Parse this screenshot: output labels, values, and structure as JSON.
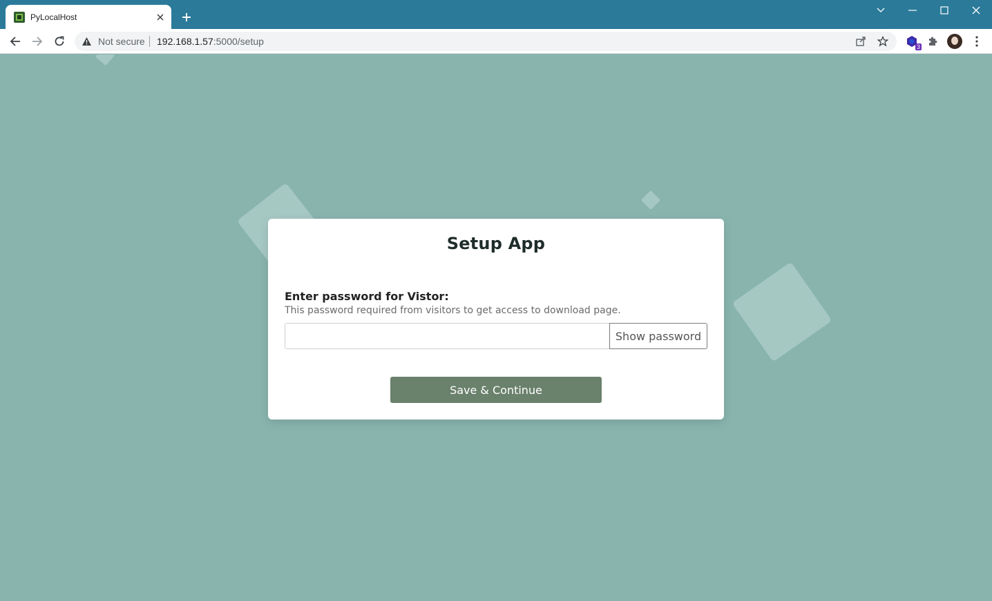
{
  "browser": {
    "tab": {
      "title": "PyLocalHost"
    },
    "address_bar": {
      "security_label": "Not secure",
      "url_host": "192.168.1.57",
      "url_rest": ":5000/setup"
    },
    "extension_badge": "3"
  },
  "setup": {
    "title": "Setup App",
    "password_label": "Enter password for Vistor:",
    "password_help": "This password required from visitors to get access to download page.",
    "password_value": "",
    "show_password_label": "Show password",
    "save_label": "Save & Continue"
  },
  "colors": {
    "titlebar": "#2b7a9a",
    "page_background": "#89b4ae",
    "shape": "#a6c8c3",
    "primary_button": "#6a816c"
  }
}
